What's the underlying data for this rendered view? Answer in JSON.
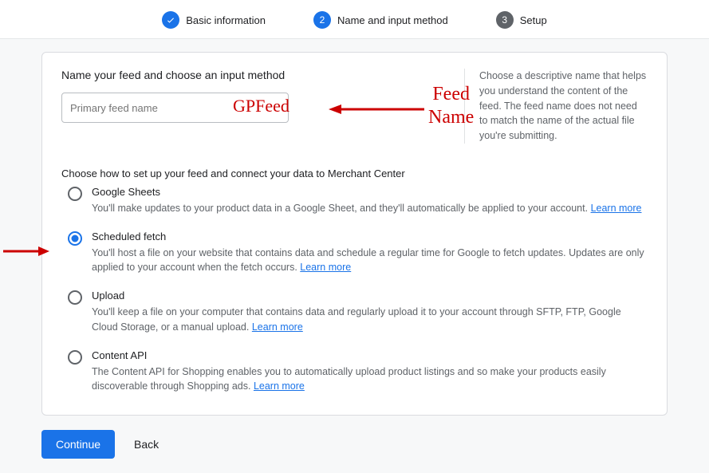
{
  "stepper": {
    "steps": [
      {
        "num": "",
        "label": "Basic information",
        "state": "done"
      },
      {
        "num": "2",
        "label": "Name and input method",
        "state": "active"
      },
      {
        "num": "3",
        "label": "Setup",
        "state": "pending"
      }
    ]
  },
  "form": {
    "heading": "Name your feed and choose an input method",
    "feed_input_placeholder": "Primary feed name",
    "feed_input_value": "",
    "help_text": "Choose a descriptive name that helps you understand the content of the feed. The feed name does not need to match the name of the actual file you're submitting.",
    "sub_heading": "Choose how to set up your feed and connect your data to Merchant Center",
    "options": [
      {
        "id": "google-sheets",
        "title": "Google Sheets",
        "desc": "You'll make updates to your product data in a Google Sheet, and they'll automatically be applied to your account.",
        "learn_more": "Learn more",
        "selected": false
      },
      {
        "id": "scheduled-fetch",
        "title": "Scheduled fetch",
        "desc": "You'll host a file on your website that contains data and schedule a regular time for Google to fetch updates. Updates are only applied to your account when the fetch occurs.",
        "learn_more": "Learn more",
        "selected": true
      },
      {
        "id": "upload",
        "title": "Upload",
        "desc": "You'll keep a file on your computer that contains data and regularly upload it to your account through SFTP, FTP, Google Cloud Storage, or a manual upload.",
        "learn_more": "Learn more",
        "selected": false
      },
      {
        "id": "content-api",
        "title": "Content API",
        "desc": "The Content API for Shopping enables you to automatically upload product listings and so make your products easily discoverable through Shopping ads.",
        "learn_more": "Learn more",
        "selected": false
      }
    ]
  },
  "actions": {
    "continue": "Continue",
    "back": "Back"
  },
  "annotations": {
    "feed_value_overlay": "GPFeed",
    "feed_label_line1": "Feed",
    "feed_label_line2": "Name"
  }
}
